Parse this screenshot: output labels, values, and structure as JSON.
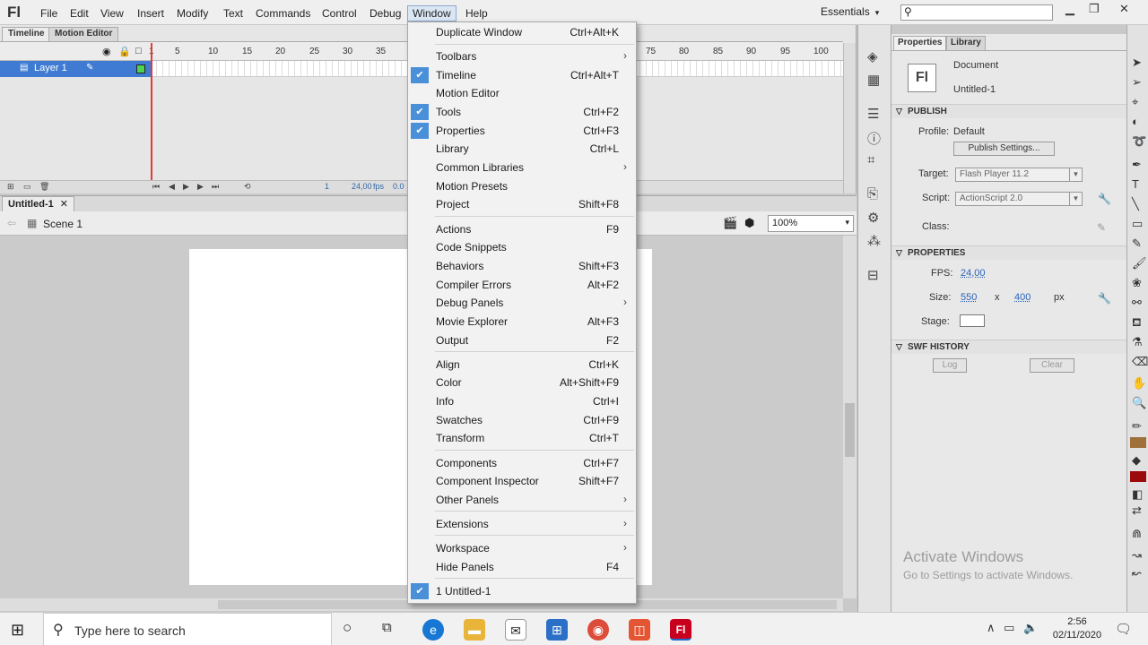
{
  "app": {
    "logo": "Fl"
  },
  "menubar": {
    "items": [
      "File",
      "Edit",
      "View",
      "Insert",
      "Modify",
      "Text",
      "Commands",
      "Control",
      "Debug",
      "Window",
      "Help"
    ],
    "workspace": "Essentials",
    "search_placeholder": ""
  },
  "timeline": {
    "tabs": [
      "Timeline",
      "Motion Editor"
    ],
    "layer_name": "Layer 1",
    "frame_numbers": [
      "1",
      "5",
      "10",
      "15",
      "20",
      "25",
      "30",
      "35",
      "75",
      "80",
      "85",
      "90",
      "95",
      "100"
    ],
    "current_frame": "1",
    "fps": "24,00",
    "fps_unit": "fps",
    "elapsed": "0.0"
  },
  "document": {
    "tab": "Untitled-1",
    "scene": "Scene 1",
    "zoom": "100%"
  },
  "window_menu": {
    "items": [
      {
        "label": "Duplicate Window",
        "shortcut": "Ctrl+Alt+K",
        "checked": false,
        "submenu": false
      },
      {
        "label": "Toolbars",
        "shortcut": "",
        "checked": false,
        "submenu": true
      },
      {
        "label": "Timeline",
        "shortcut": "Ctrl+Alt+T",
        "checked": true,
        "submenu": false
      },
      {
        "label": "Motion Editor",
        "shortcut": "",
        "checked": false,
        "submenu": false
      },
      {
        "label": "Tools",
        "shortcut": "Ctrl+F2",
        "checked": true,
        "submenu": false
      },
      {
        "label": "Properties",
        "shortcut": "Ctrl+F3",
        "checked": true,
        "submenu": false
      },
      {
        "label": "Library",
        "shortcut": "Ctrl+L",
        "checked": false,
        "submenu": false
      },
      {
        "label": "Common Libraries",
        "shortcut": "",
        "checked": false,
        "submenu": true
      },
      {
        "label": "Motion Presets",
        "shortcut": "",
        "checked": false,
        "submenu": false
      },
      {
        "label": "Project",
        "shortcut": "Shift+F8",
        "checked": false,
        "submenu": false
      },
      {
        "label": "Actions",
        "shortcut": "F9",
        "checked": false,
        "submenu": false
      },
      {
        "label": "Code Snippets",
        "shortcut": "",
        "checked": false,
        "submenu": false
      },
      {
        "label": "Behaviors",
        "shortcut": "Shift+F3",
        "checked": false,
        "submenu": false
      },
      {
        "label": "Compiler Errors",
        "shortcut": "Alt+F2",
        "checked": false,
        "submenu": false
      },
      {
        "label": "Debug Panels",
        "shortcut": "",
        "checked": false,
        "submenu": true
      },
      {
        "label": "Movie Explorer",
        "shortcut": "Alt+F3",
        "checked": false,
        "submenu": false
      },
      {
        "label": "Output",
        "shortcut": "F2",
        "checked": false,
        "submenu": false
      },
      {
        "label": "Align",
        "shortcut": "Ctrl+K",
        "checked": false,
        "submenu": false
      },
      {
        "label": "Color",
        "shortcut": "Alt+Shift+F9",
        "checked": false,
        "submenu": false
      },
      {
        "label": "Info",
        "shortcut": "Ctrl+I",
        "checked": false,
        "submenu": false
      },
      {
        "label": "Swatches",
        "shortcut": "Ctrl+F9",
        "checked": false,
        "submenu": false
      },
      {
        "label": "Transform",
        "shortcut": "Ctrl+T",
        "checked": false,
        "submenu": false
      },
      {
        "label": "Components",
        "shortcut": "Ctrl+F7",
        "checked": false,
        "submenu": false
      },
      {
        "label": "Component Inspector",
        "shortcut": "Shift+F7",
        "checked": false,
        "submenu": false
      },
      {
        "label": "Other Panels",
        "shortcut": "",
        "checked": false,
        "submenu": true
      },
      {
        "label": "Extensions",
        "shortcut": "",
        "checked": false,
        "submenu": true
      },
      {
        "label": "Workspace",
        "shortcut": "",
        "checked": false,
        "submenu": true
      },
      {
        "label": "Hide Panels",
        "shortcut": "F4",
        "checked": false,
        "submenu": false
      },
      {
        "label": "1 Untitled-1",
        "shortcut": "",
        "checked": true,
        "submenu": false
      }
    ]
  },
  "properties": {
    "tabs": [
      "Properties",
      "Library"
    ],
    "doc_icon": "Fl",
    "doc_type": "Document",
    "doc_name": "Untitled-1",
    "publish_header": "PUBLISH",
    "profile_label": "Profile:",
    "profile_value": "Default",
    "publish_settings_btn": "Publish Settings...",
    "target_label": "Target:",
    "target_value": "Flash Player 11.2",
    "script_label": "Script:",
    "script_value": "ActionScript 2.0",
    "class_label": "Class:",
    "properties_header": "PROPERTIES",
    "fps_label": "FPS:",
    "fps_value": "24,00",
    "size_label": "Size:",
    "size_w": "550",
    "size_x": "x",
    "size_h": "400",
    "size_unit": "px",
    "stage_label": "Stage:",
    "stage_color": "#ffffff",
    "swf_header": "SWF HISTORY",
    "log_btn": "Log",
    "clear_btn": "Clear"
  },
  "watermark": {
    "title": "Activate Windows",
    "subtitle": "Go to Settings to activate Windows."
  },
  "taskbar": {
    "search_text": "Type here to search",
    "time": "2:56",
    "date": "02/11/2020"
  },
  "colors": {
    "menu_check": "#4a90d9",
    "layer_selected": "#3f7bd2",
    "playhead": "#e23b3b",
    "flash_app": "#c8001e"
  }
}
